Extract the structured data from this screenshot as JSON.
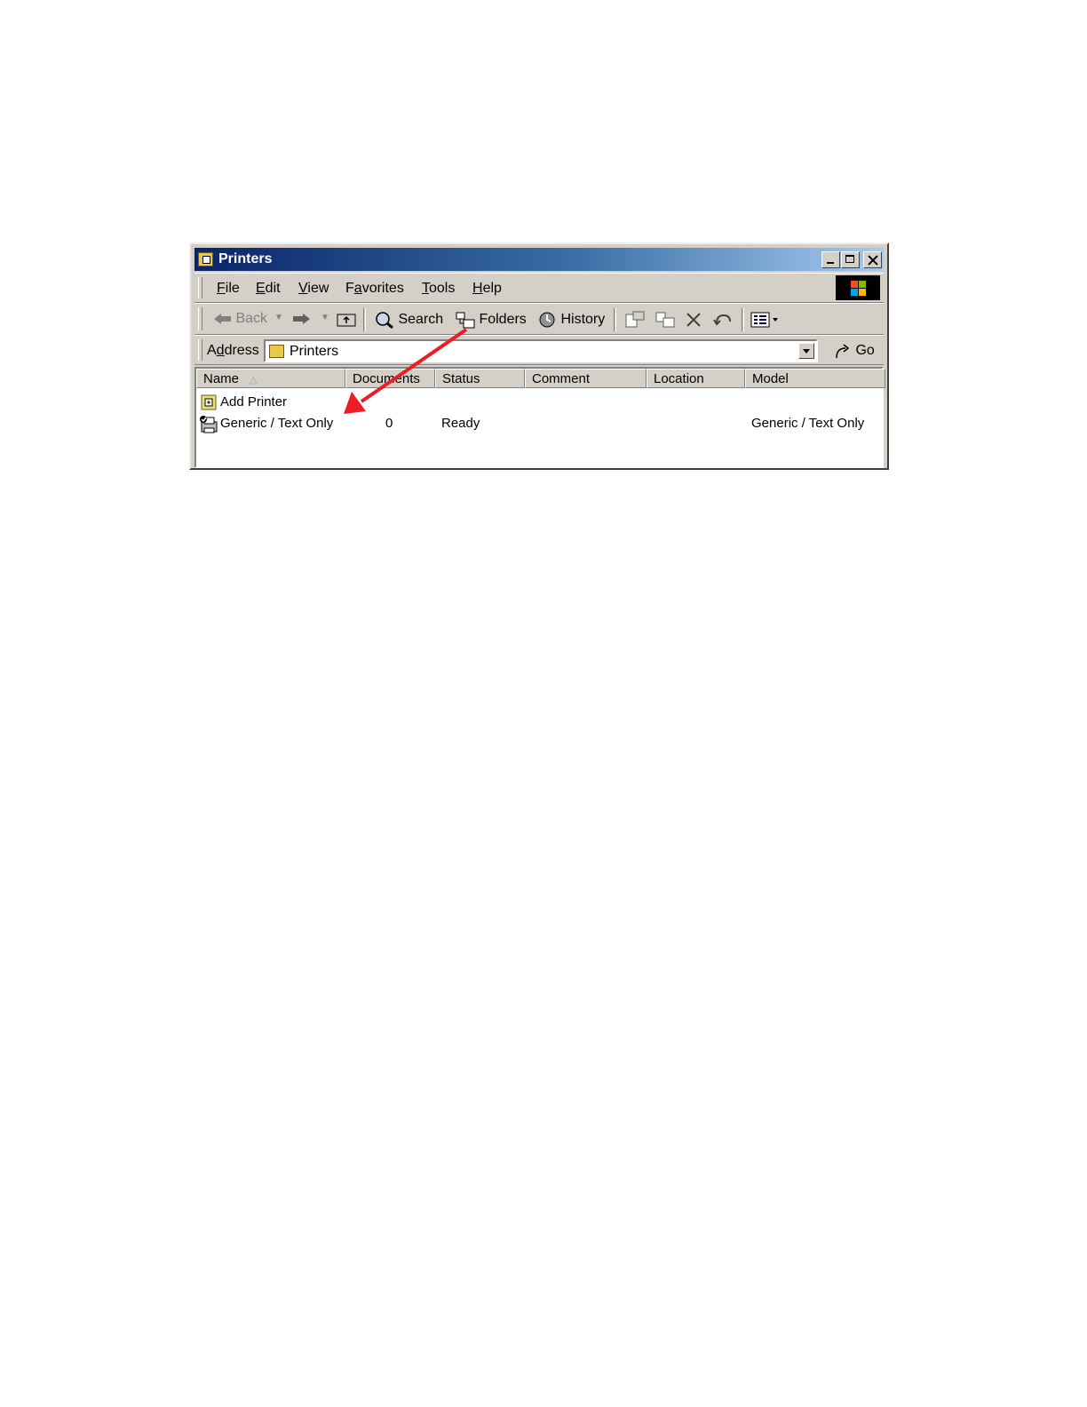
{
  "window": {
    "title": "Printers"
  },
  "menu": {
    "items": [
      {
        "key": "F",
        "rest": "ile"
      },
      {
        "key": "E",
        "rest": "dit"
      },
      {
        "key": "V",
        "rest": "iew"
      },
      {
        "pre": "F",
        "key": "a",
        "rest": "vorites"
      },
      {
        "key": "T",
        "rest": "ools"
      },
      {
        "key": "H",
        "rest": "elp"
      }
    ]
  },
  "toolbar": {
    "back_label": "Back",
    "search_label": "Search",
    "folders_label": "Folders",
    "history_label": "History"
  },
  "address": {
    "label_pre": "A",
    "label_key": "d",
    "label_rest": "dress",
    "value": "Printers",
    "go_label": "Go"
  },
  "list": {
    "columns": [
      "Name",
      "Documents",
      "Status",
      "Comment",
      "Location",
      "Model"
    ],
    "sort_indicator": "△",
    "rows": [
      {
        "name": "Add Printer",
        "documents": "",
        "status": "",
        "comment": "",
        "location": "",
        "model": ""
      },
      {
        "name": "Generic / Text Only",
        "documents": "0",
        "status": "Ready",
        "comment": "",
        "location": "",
        "model": "Generic / Text Only"
      }
    ]
  },
  "annotation": {
    "arrow_color": "#ee1c24"
  },
  "colors": {
    "titlebar_start": "#0a246a",
    "titlebar_end": "#a6caf0",
    "face": "#d4d0c8"
  }
}
